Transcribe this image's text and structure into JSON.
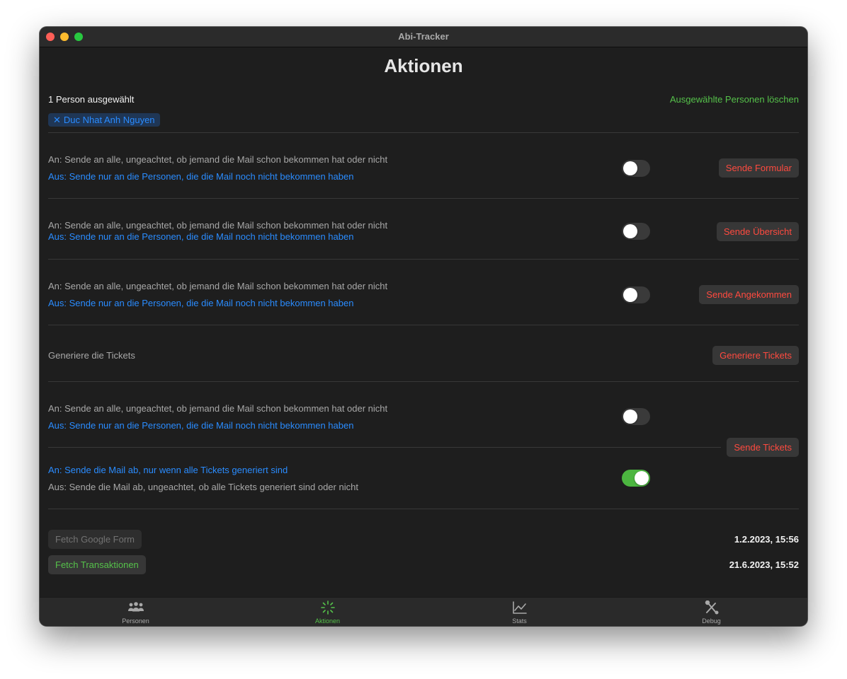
{
  "window": {
    "title": "Abi-Tracker"
  },
  "page": {
    "title": "Aktionen"
  },
  "selection": {
    "count_label": "1 Person ausgewählt",
    "clear_label": "Ausgewählte Personen löschen",
    "chips": [
      {
        "name": "Duc Nhat Anh Nguyen"
      }
    ]
  },
  "sections": {
    "formular": {
      "on_text": "An: Sende an alle, ungeachtet, ob jemand die Mail schon bekommen hat oder nicht",
      "off_text": "Aus: Sende nur an die Personen, die die Mail noch nicht bekommen haben",
      "toggle_on": false,
      "button": "Sende Formular"
    },
    "uebersicht": {
      "on_text": "An: Sende an alle, ungeachtet, ob jemand die Mail schon bekommen hat oder nicht",
      "off_text": "Aus: Sende nur an die Personen, die die Mail noch nicht bekommen haben",
      "toggle_on": false,
      "button": "Sende Übersicht"
    },
    "angekommen": {
      "on_text": "An: Sende an alle, ungeachtet, ob jemand die Mail schon bekommen hat oder nicht",
      "off_text": "Aus: Sende nur an die Personen, die die Mail noch nicht bekommen haben",
      "toggle_on": false,
      "button": "Sende Angekommen"
    },
    "generate": {
      "text": "Generiere die Tickets",
      "button": "Generiere Tickets"
    },
    "tickets": {
      "on_text": "An: Sende an alle, ungeachtet, ob jemand die Mail schon bekommen hat oder nicht",
      "off_text": "Aus: Sende nur an die Personen, die die Mail noch nicht bekommen haben",
      "toggle_on": false,
      "only_generated_on_text": "An: Sende die Mail ab, nur wenn alle Tickets generiert sind",
      "only_generated_off_text": "Aus: Sende die Mail ab, ungeachtet, ob alle Tickets generiert sind oder nicht",
      "only_generated_toggle_on": true,
      "button": "Sende Tickets"
    }
  },
  "fetch": {
    "google_form": {
      "label": "Fetch Google Form",
      "date": "1.2.2023, 15:56",
      "enabled": false
    },
    "transaktionen": {
      "label": "Fetch Transaktionen",
      "date": "21.6.2023, 15:52",
      "enabled": true
    }
  },
  "tabs": [
    {
      "label": "Personen",
      "icon": "people-icon",
      "active": false
    },
    {
      "label": "Aktionen",
      "icon": "sparkle-icon",
      "active": true
    },
    {
      "label": "Stats",
      "icon": "chart-icon",
      "active": false
    },
    {
      "label": "Debug",
      "icon": "tools-icon",
      "active": false
    }
  ],
  "colors": {
    "accent_green": "#55c14a",
    "accent_blue": "#2a8cff",
    "destructive_red": "#ff4a3f",
    "background": "#1e1e1e"
  }
}
